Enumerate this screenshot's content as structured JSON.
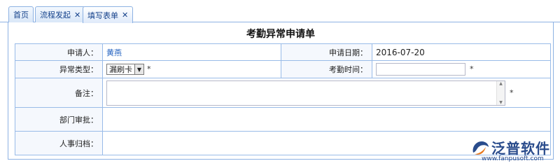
{
  "tabs": [
    {
      "label": "首页",
      "closable": false
    },
    {
      "label": "流程发起",
      "closable": true
    },
    {
      "label": "填写表单",
      "closable": true,
      "active": true
    }
  ],
  "form": {
    "title": "考勤异常申请单",
    "applicant_label": "申请人：",
    "applicant_value": "黄燕",
    "apply_date_label": "申请日期：",
    "apply_date_value": "2016-07-20",
    "exception_type_label": "异常类型：",
    "exception_type_value": "漏刷卡",
    "attendance_time_label": "考勤时间：",
    "remark_label": "备注：",
    "dept_approval_label": "部门审批：",
    "hr_archive_label": "人事归档：",
    "required_mark": "*"
  },
  "logo": {
    "brand": "泛普软件",
    "url": "www.fanpusoft.com"
  },
  "colors": {
    "tab_border": "#8db2e3",
    "tab_text": "#15428b",
    "label_bg": "#f5f8fd",
    "applicant_value": "#1f5fbf",
    "brand": "#2a4c8c"
  }
}
